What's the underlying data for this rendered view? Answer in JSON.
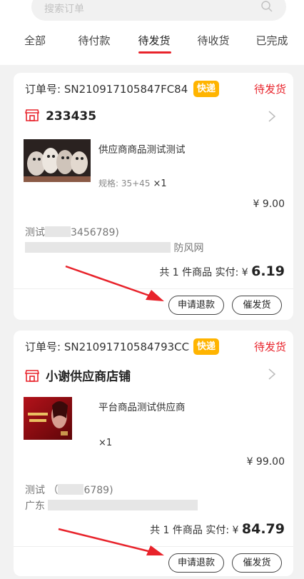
{
  "search": {
    "placeholder": "搜索订单"
  },
  "tabs": [
    {
      "label": "全部"
    },
    {
      "label": "待付款"
    },
    {
      "label": "待发货",
      "active": true
    },
    {
      "label": "待收货"
    },
    {
      "label": "已完成"
    }
  ],
  "accent_color": "#e8232b",
  "badge_color": "#ffb400",
  "orders": [
    {
      "order_no_label": "订单号: SN210917105847FC84",
      "badge": "快递",
      "status": "待发货",
      "shop_name": "233435",
      "product_name": "供应商商品测试测试",
      "spec": "规格: 35+45",
      "qty": "×1",
      "price": "¥ 9.00",
      "contact_name": "测试",
      "contact_phone": "3456789)",
      "address_tail": "防风网",
      "summary_prefix": "共 1 件商品 实付: ¥",
      "total": "6.19",
      "btn_refund": "申请退款",
      "btn_ship": "催发货"
    },
    {
      "order_no_label": "订单号: SN21091710584793CC",
      "badge": "快递",
      "status": "待发货",
      "shop_name": "小谢供应商店铺",
      "product_name": "平台商品测试供应商",
      "qty": "×1",
      "price": "¥ 99.00",
      "contact_name": "测试 （",
      "contact_phone": "6789)",
      "address_head": "广东",
      "summary_prefix": "共 1 件商品 实付: ¥",
      "total": "84.79",
      "btn_refund": "申请退款",
      "btn_ship": "催发货"
    }
  ]
}
